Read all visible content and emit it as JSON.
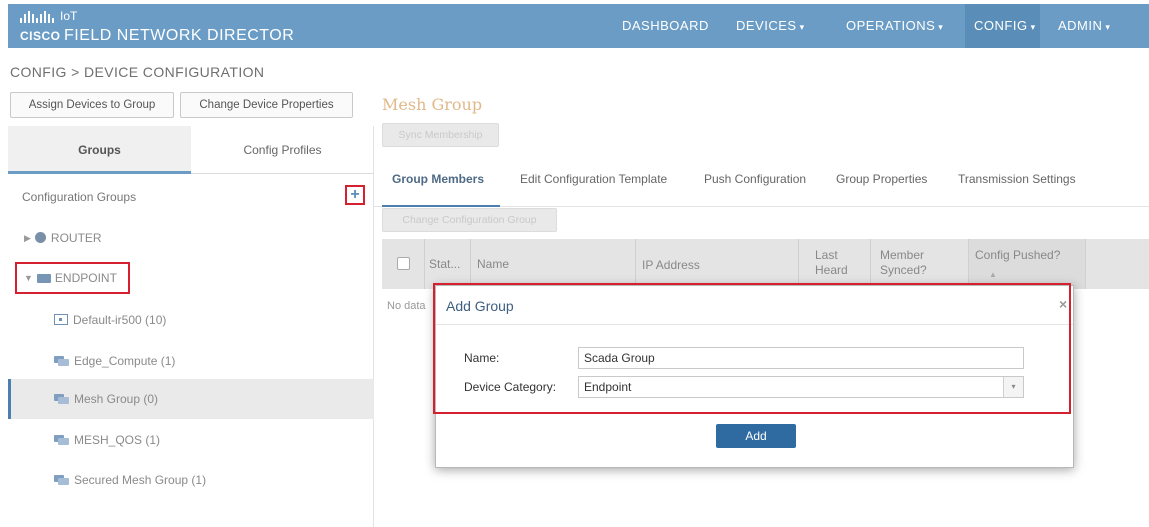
{
  "header": {
    "brand_small": "IoT",
    "brand_company": "CISCO",
    "brand_product": "FIELD NETWORK DIRECTOR",
    "nav": [
      {
        "label": "DASHBOARD",
        "chevron": ""
      },
      {
        "label": "DEVICES",
        "chevron": "▾"
      },
      {
        "label": "OPERATIONS",
        "chevron": "▾"
      },
      {
        "label": "CONFIG",
        "chevron": "▾"
      },
      {
        "label": "ADMIN",
        "chevron": "▾"
      }
    ],
    "active_nav": "CONFIG",
    "bar_color": "#6a9cc5"
  },
  "breadcrumb": "CONFIG > DEVICE CONFIGURATION",
  "toolbar": {
    "assign_label": "Assign Devices to Group",
    "change_props_label": "Change Device Properties"
  },
  "left_panel": {
    "tabs": [
      {
        "label": "Groups",
        "active": true
      },
      {
        "label": "Config Profiles",
        "active": false
      }
    ],
    "config_groups_label": "Configuration Groups",
    "add_icon": "plus-icon",
    "add_glyph": "+",
    "tree": {
      "router": {
        "label": "ROUTER",
        "icon": "router-icon"
      },
      "endpoint": {
        "label": "ENDPOINT",
        "icon": "folder-icon"
      },
      "children": [
        {
          "label": "Default-ir500 (10)",
          "icon": "device-icon",
          "selected": false
        },
        {
          "label": "Edge_Compute (1)",
          "icon": "group-icon",
          "selected": false
        },
        {
          "label": "Mesh Group (0)",
          "icon": "group-icon",
          "selected": true
        },
        {
          "label": "MESH_QOS (1)",
          "icon": "group-icon",
          "selected": false
        },
        {
          "label": "Secured Mesh Group (1)",
          "icon": "group-icon",
          "selected": false
        }
      ]
    }
  },
  "main": {
    "title": "Mesh Group",
    "sync_membership_label": "Sync Membership",
    "tabs": [
      {
        "label": "Group Members",
        "active": true
      },
      {
        "label": "Edit Configuration Template",
        "active": false
      },
      {
        "label": "Push Configuration",
        "active": false
      },
      {
        "label": "Group Properties",
        "active": false
      },
      {
        "label": "Transmission Settings",
        "active": false
      }
    ],
    "change_config_group_label": "Change Configuration Group",
    "table": {
      "columns": [
        "Stat...",
        "Name",
        "IP Address",
        "Last Heard",
        "Member Synced?",
        "Config Pushed?"
      ],
      "last_heard_lines": [
        "Last",
        "Heard"
      ],
      "member_synced_lines": [
        "Member",
        "Synced?"
      ],
      "sort_glyph": "▲",
      "empty_text": "No data"
    }
  },
  "modal": {
    "title": "Add Group",
    "close_glyph": "×",
    "name_label": "Name:",
    "name_value": "Scada Group",
    "category_label": "Device Category:",
    "category_value": "Endpoint",
    "dropdown_glyph": "▾",
    "add_label": "Add"
  },
  "annotation_color": "#d4202f"
}
